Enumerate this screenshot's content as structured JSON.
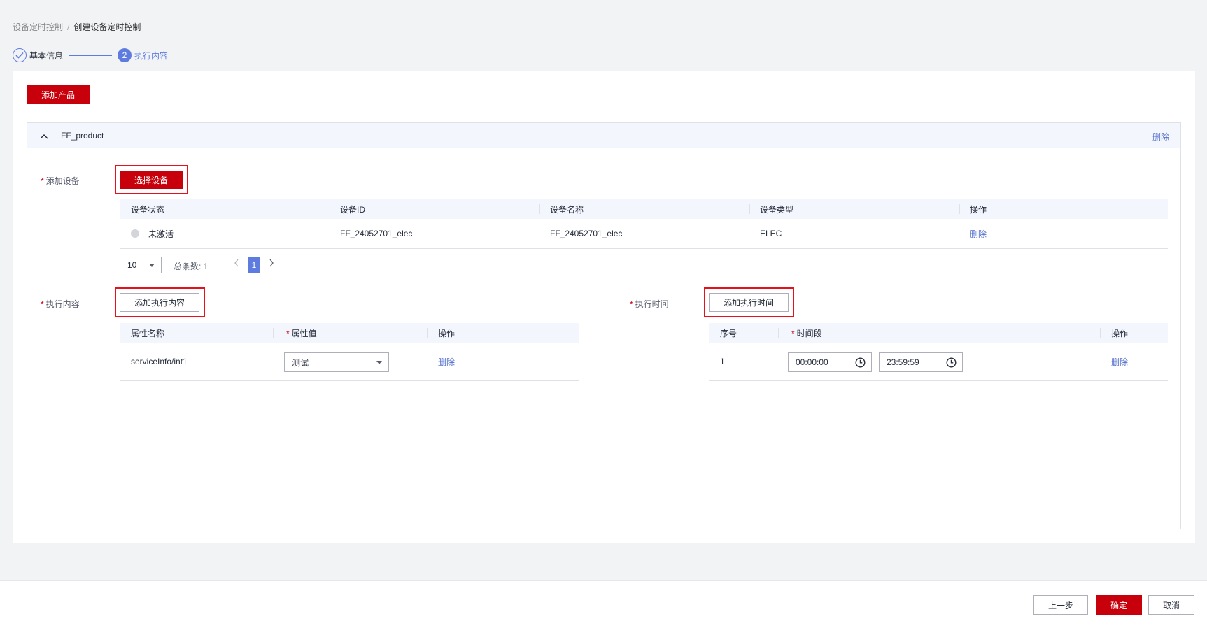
{
  "breadcrumb": {
    "parent": "设备定时控制",
    "separator": "/",
    "current": "创建设备定时控制"
  },
  "steps": [
    {
      "label": "基本信息",
      "status": "done"
    },
    {
      "label": "执行内容",
      "status": "active",
      "number": "2"
    }
  ],
  "toolbar": {
    "add_product_label": "添加产品"
  },
  "product_panel": {
    "name": "FF_product",
    "delete_label": "删除",
    "add_device": {
      "label": "添加设备",
      "select_button": "选择设备",
      "columns": [
        "设备状态",
        "设备ID",
        "设备名称",
        "设备类型",
        "操作"
      ],
      "rows": [
        {
          "status": "未激活",
          "device_id": "FF_24052701_elec",
          "device_name": "FF_24052701_elec",
          "device_type": "ELEC",
          "action": "删除"
        }
      ],
      "pagination": {
        "page_size": "10",
        "total_label": "总条数: 1",
        "current_page": "1"
      }
    },
    "exec_content": {
      "label": "执行内容",
      "add_button": "添加执行内容",
      "columns": [
        "属性名称",
        "属性值",
        "操作"
      ],
      "rows": [
        {
          "attr_name": "serviceInfo/int1",
          "attr_value": "测试",
          "action": "删除"
        }
      ]
    },
    "exec_time": {
      "label": "执行时间",
      "add_button": "添加执行时间",
      "columns": [
        "序号",
        "时间段",
        "操作"
      ],
      "rows": [
        {
          "index": "1",
          "start": "00:00:00",
          "end": "23:59:59",
          "action": "删除"
        }
      ]
    }
  },
  "footer": {
    "prev_label": "上一步",
    "confirm_label": "确定",
    "cancel_label": "取消"
  },
  "colors": {
    "brand_red": "#c7000b",
    "link_blue": "#526ecc",
    "step_blue": "#5e7ce0",
    "highlight_red": "#e5121c"
  }
}
